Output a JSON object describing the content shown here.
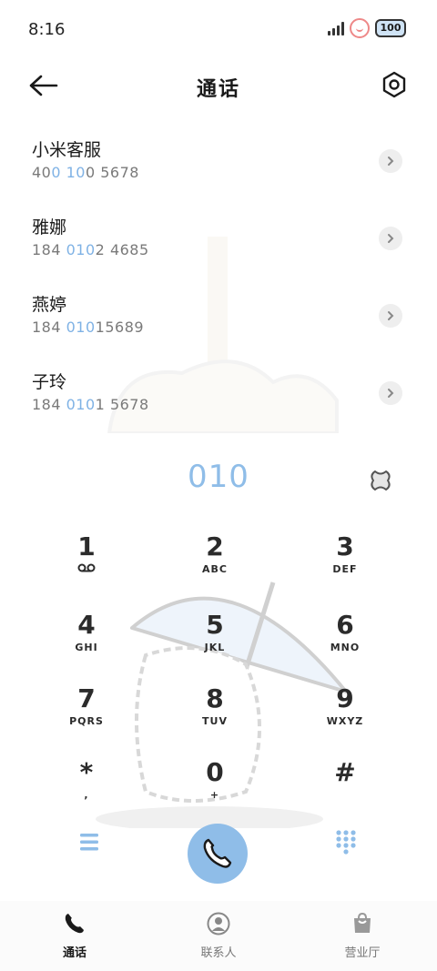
{
  "status_bar": {
    "time": "8:16",
    "battery": "100"
  },
  "header": {
    "title": "通话"
  },
  "results": [
    {
      "name": "小米客服",
      "num_a": "40",
      "num_b": "0 10",
      "num_c": "0 5678"
    },
    {
      "name": "雅娜",
      "num_a": "184 ",
      "num_b": "010",
      "num_c": "2 4685"
    },
    {
      "name": "燕婷",
      "num_a": "184 ",
      "num_b": "010",
      "num_c": "15689"
    },
    {
      "name": "子玲",
      "num_a": "184 ",
      "num_b": "010",
      "num_c": "1 5678"
    }
  ],
  "dial": {
    "input": "010"
  },
  "keypad": [
    {
      "digit": "1",
      "letters": ""
    },
    {
      "digit": "2",
      "letters": "ABC"
    },
    {
      "digit": "3",
      "letters": "DEF"
    },
    {
      "digit": "4",
      "letters": "GHI"
    },
    {
      "digit": "5",
      "letters": "JKL"
    },
    {
      "digit": "6",
      "letters": "MNO"
    },
    {
      "digit": "7",
      "letters": "PQRS"
    },
    {
      "digit": "8",
      "letters": "TUV"
    },
    {
      "digit": "9",
      "letters": "WXYZ"
    },
    {
      "digit": "*",
      "letters": ","
    },
    {
      "digit": "0",
      "letters": "+"
    },
    {
      "digit": "#",
      "letters": ""
    }
  ],
  "nav": [
    {
      "label": "通话",
      "icon": "phone-icon",
      "active": true
    },
    {
      "label": "联系人",
      "icon": "person-icon",
      "active": false
    },
    {
      "label": "营业厅",
      "icon": "bag-icon",
      "active": false
    }
  ],
  "colors": {
    "accent": "#8fbde8",
    "highlight": "#7fb2e5",
    "text": "#1a1a1a",
    "muted": "#7a7a7a"
  }
}
